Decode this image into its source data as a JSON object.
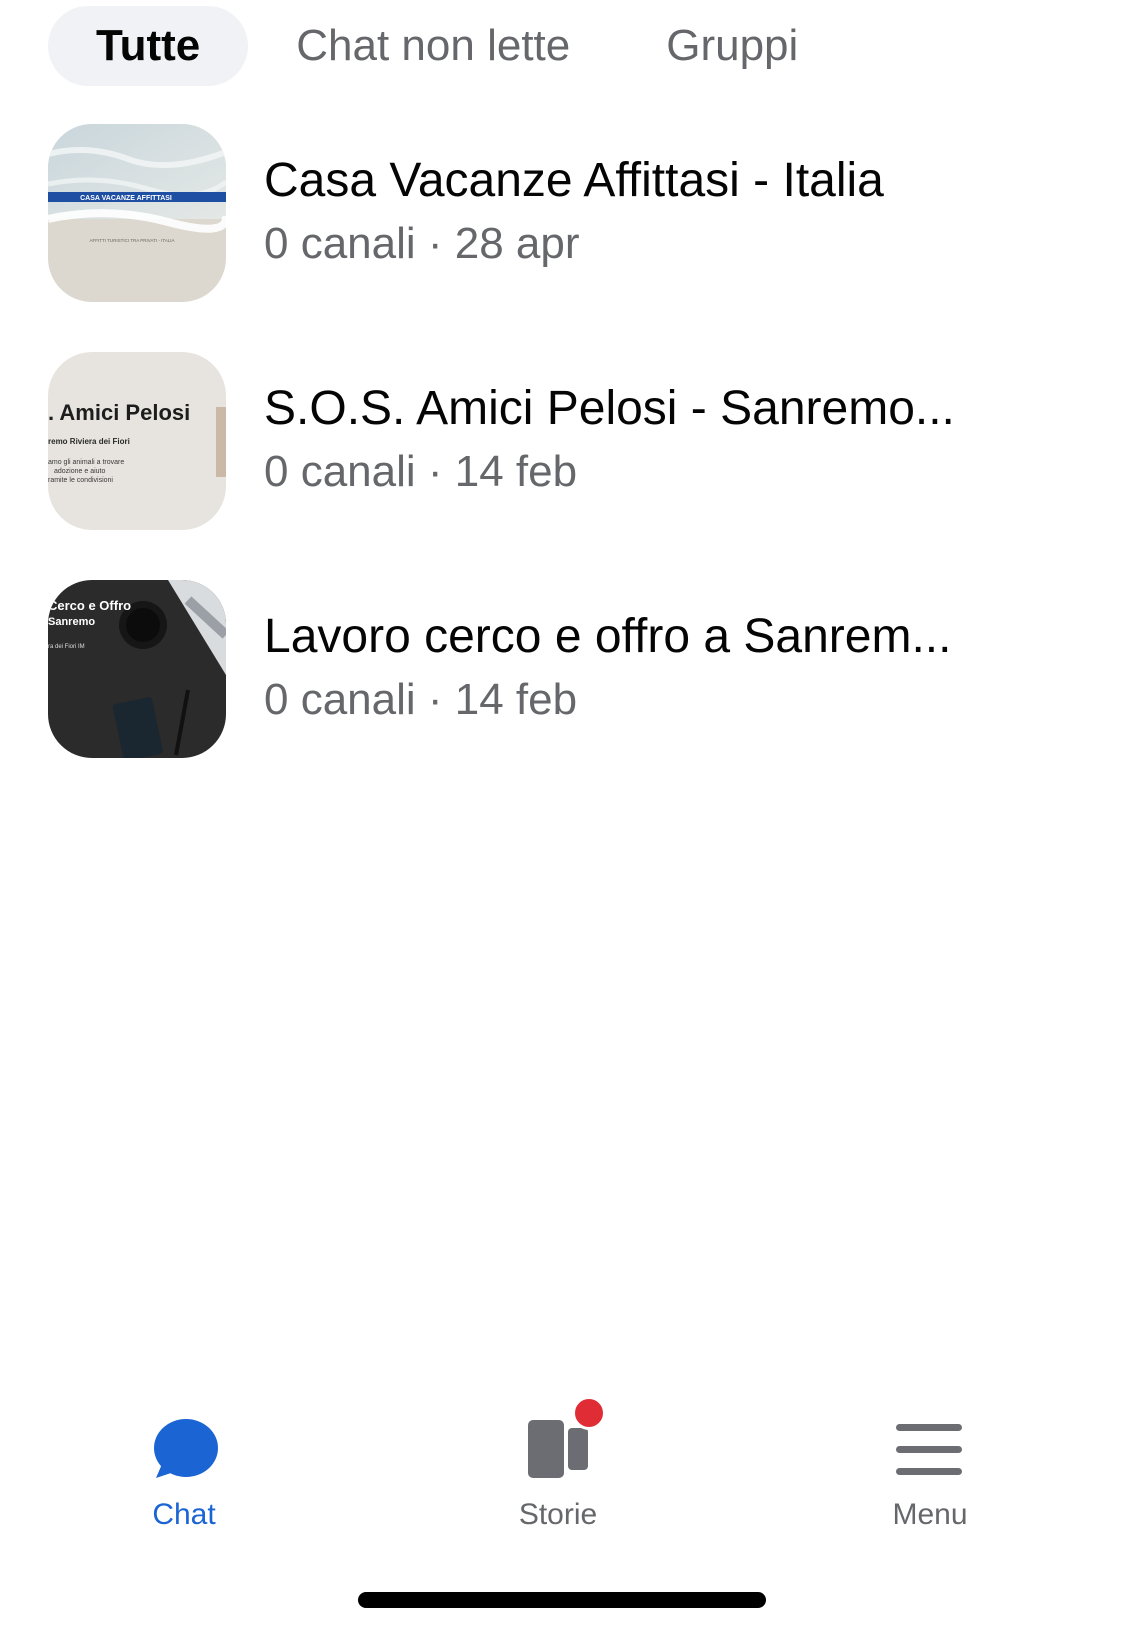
{
  "filter_tabs": [
    {
      "label": "Tutte",
      "active": true
    },
    {
      "label": "Chat non lette",
      "active": false
    },
    {
      "label": "Gruppi",
      "active": false
    }
  ],
  "chats": [
    {
      "title": "Casa Vacanze Affittasi - Italia",
      "subtitle": "0 canali · 28 apr",
      "thumb_banner": "CASA VACANZE AFFITTASI",
      "thumb_caption": "AFFITTI TURISTICI TRA PRIVATI - ITALIA"
    },
    {
      "title": "S.O.S. Amici Pelosi - Sanremo...",
      "subtitle": "0 canali · 14 feb",
      "thumb_heading": ". Amici Pelosi",
      "thumb_line1": "remo Riviera dei Fiori",
      "thumb_line2": "amo gli animali a trovare",
      "thumb_line3": "adozione e aiuto",
      "thumb_line4": "ramite le condivisioni"
    },
    {
      "title": "Lavoro cerco e offro a Sanrem...",
      "subtitle": "0 canali · 14 feb",
      "thumb_line1": "Cerco e Offro",
      "thumb_line2": "Sanremo",
      "thumb_line3": "ra dei Fiori IM"
    }
  ],
  "bottom_nav": {
    "chat": {
      "label": "Chat",
      "icon": "chat-bubble-icon",
      "active": true
    },
    "stories": {
      "label": "Storie",
      "icon": "stories-icon",
      "badge": true
    },
    "menu": {
      "label": "Menu",
      "icon": "hamburger-menu-icon"
    }
  },
  "colors": {
    "accent": "#1b64d3",
    "secondary_text": "#65676b",
    "active_tab_bg": "#f0f2f5",
    "badge": "#e02d35"
  }
}
